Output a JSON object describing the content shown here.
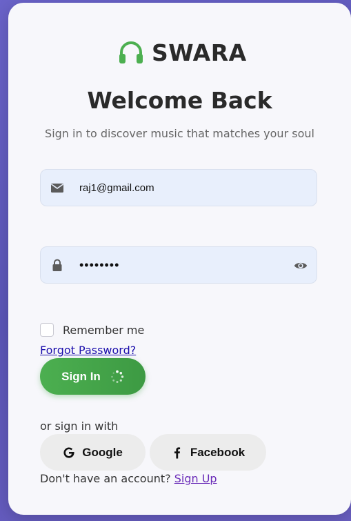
{
  "brand": {
    "name": "SWARA",
    "logo_icon": "headphones-icon",
    "accent_color": "#4caf50"
  },
  "header": {
    "title": "Welcome Back",
    "subtitle": "Sign in to discover music that matches your soul"
  },
  "form": {
    "email": {
      "icon": "envelope-icon",
      "value": "raj1@gmail.com"
    },
    "password": {
      "icon": "lock-icon",
      "value": "••••••••",
      "toggle_icon": "eye-icon"
    },
    "remember_me": {
      "label": "Remember me",
      "checked": false
    },
    "forgot_password_label": "Forgot Password?",
    "submit": {
      "label": "Sign In",
      "loading": true,
      "loading_icon": "spinner-icon"
    }
  },
  "social": {
    "prompt": "or sign in with",
    "google_label": "Google",
    "facebook_label": "Facebook"
  },
  "footer": {
    "prompt": "Don't have an account?",
    "signup_label": "Sign Up"
  }
}
